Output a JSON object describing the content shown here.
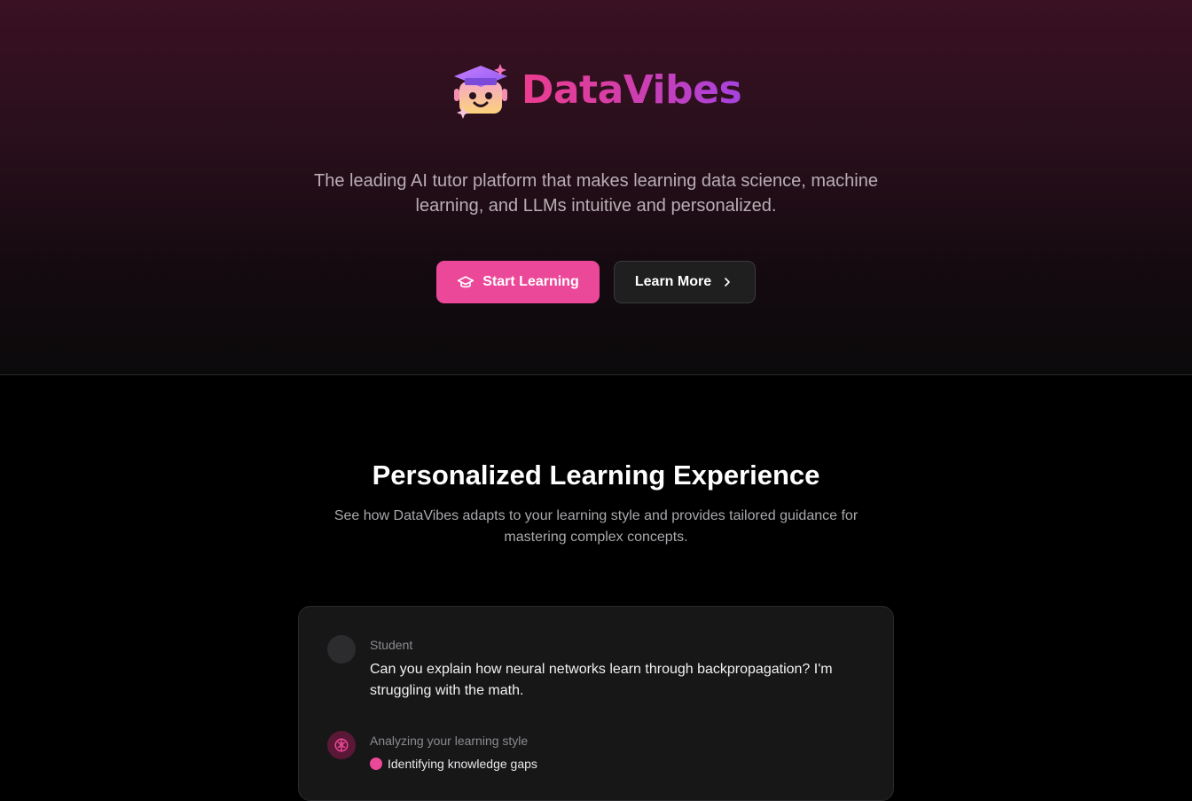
{
  "brand": {
    "name": "DataVibes",
    "gradient": [
      "#ec3d8f",
      "#a642e0"
    ]
  },
  "hero": {
    "tagline_lines": [
      "The leading AI tutor platform that makes learning data science, machine",
      "learning, and LLMs intuitive and personalized."
    ],
    "primary_button": {
      "label": "Start Learning",
      "icon": "graduation-cap-icon",
      "color": "#ec4899"
    },
    "secondary_button": {
      "label": "Learn More",
      "icon": "chevron-right-icon"
    }
  },
  "section": {
    "title": "Personalized Learning Experience",
    "subtitle_lines": [
      "See how DataVibes adapts to your learning style and provides tailored guidance for",
      "mastering complex concepts."
    ]
  },
  "chat": {
    "student": {
      "role": "Student",
      "text_lines": [
        "Can you explain how neural networks learn through backpropagation? I'm",
        "struggling with the math."
      ]
    },
    "ai": {
      "role": "Analyzing your learning style",
      "icon": "brain-icon",
      "status": "Identifying knowledge gaps"
    }
  }
}
